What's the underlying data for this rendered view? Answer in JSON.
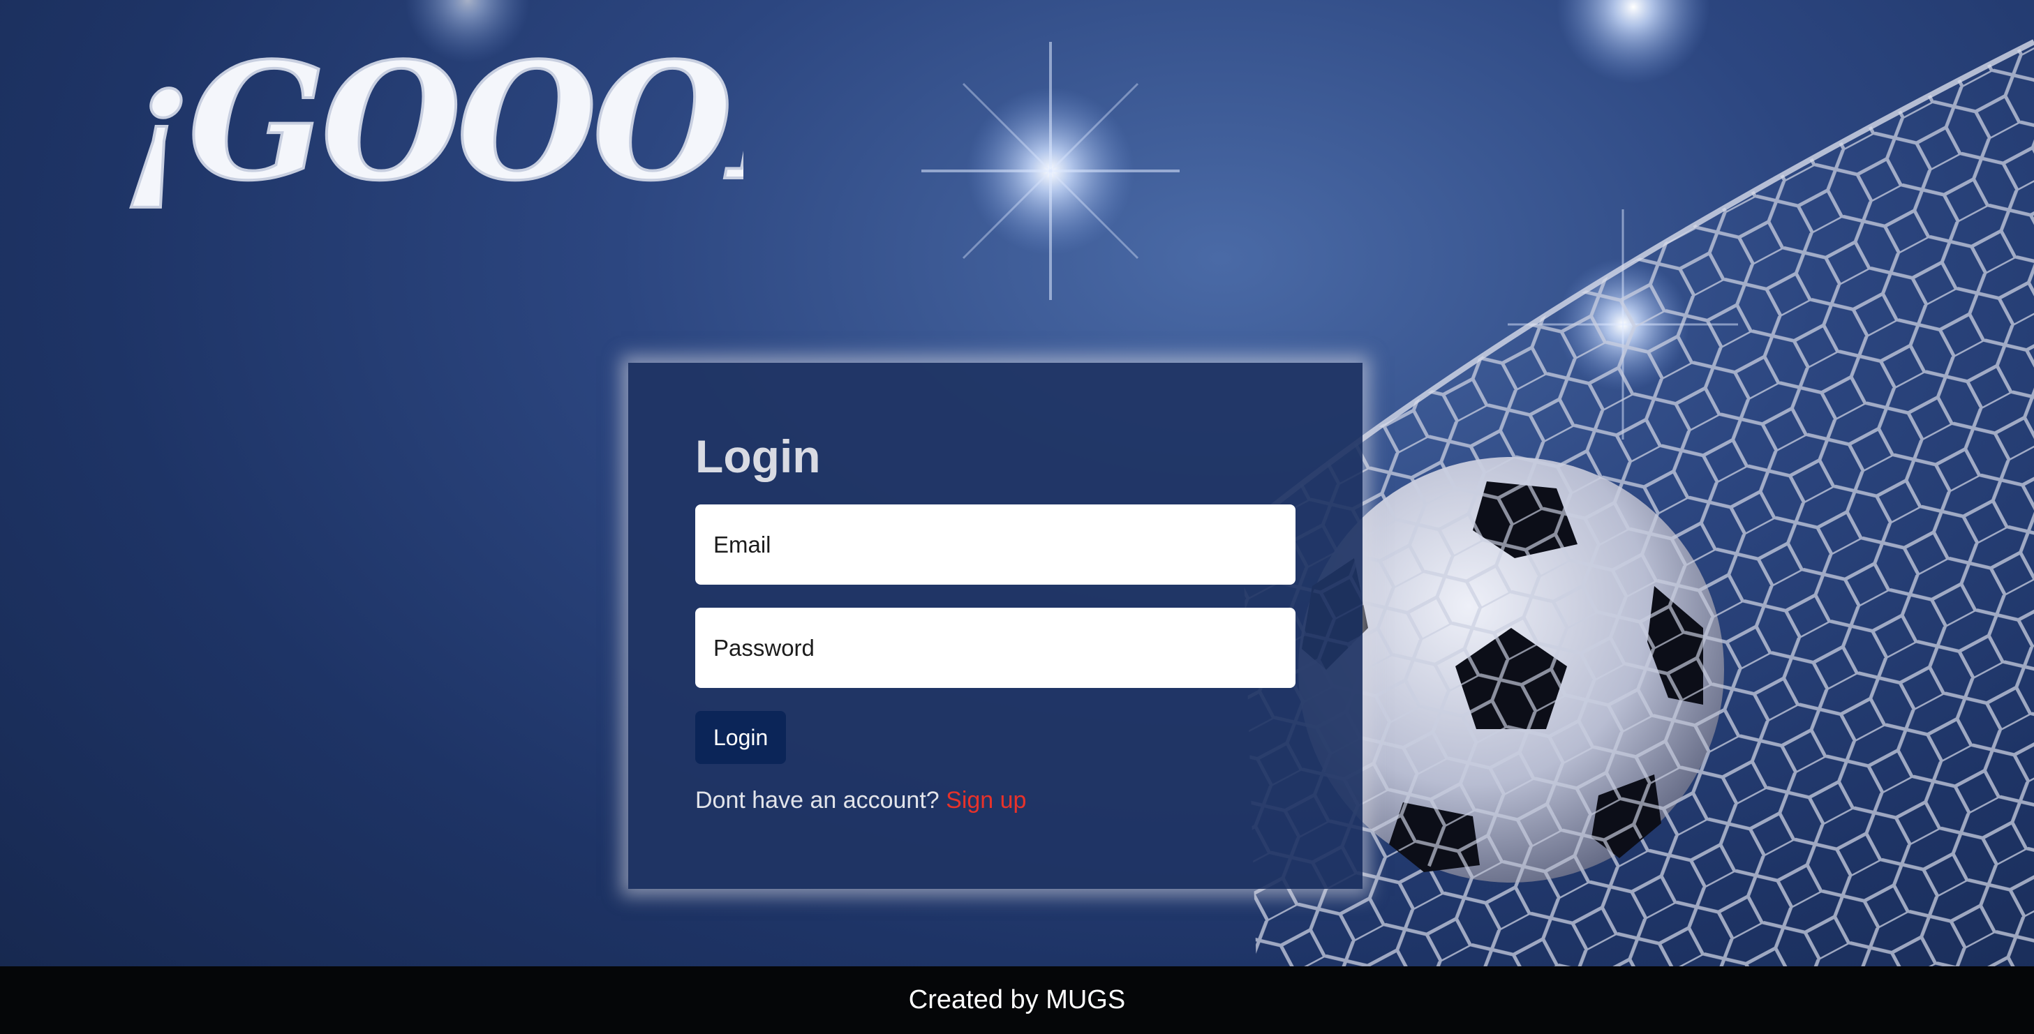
{
  "brand": {
    "logo_text": "¡GOOOL!"
  },
  "login": {
    "title": "Login",
    "email_placeholder": "Email",
    "password_placeholder": "Password",
    "submit_label": "Login",
    "signup_prompt": "Dont have an account?",
    "signup_link": "Sign up"
  },
  "footer": {
    "text": "Created by MUGS"
  },
  "icons": [
    "soccer-ball-icon",
    "goal-net-icon",
    "stadium-light-icon"
  ],
  "colors": {
    "background": "#1e3466",
    "card": "#203464",
    "button": "#0b2558",
    "link": "#e8322a",
    "footer": "#050608"
  }
}
